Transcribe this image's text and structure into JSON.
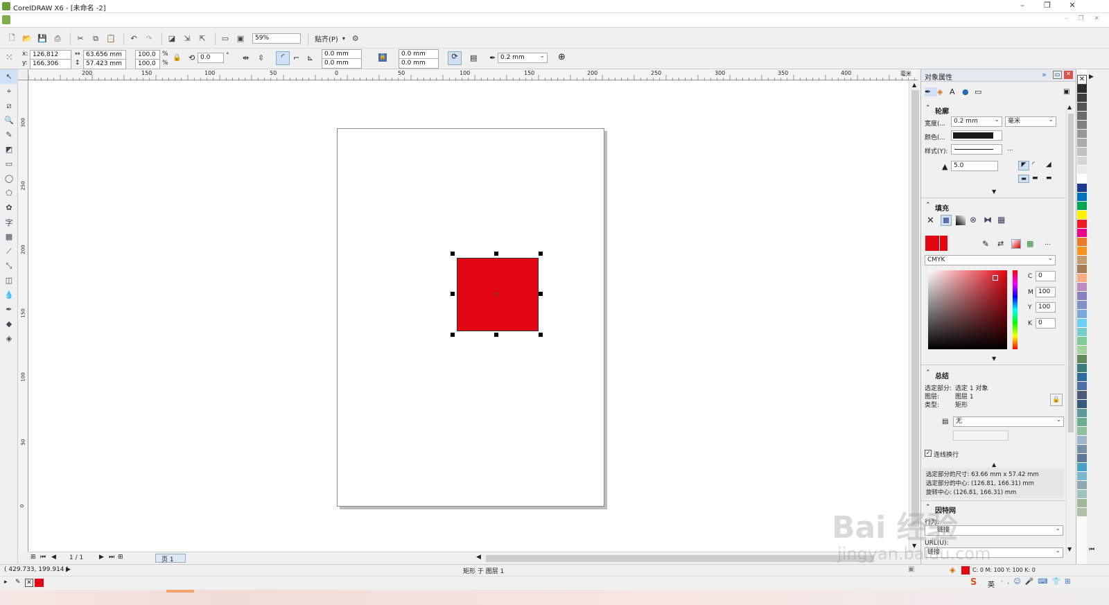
{
  "window": {
    "title": "CorelDRAW X6 - [未命名 -2]",
    "minimize": "–",
    "maximize": "❐",
    "close": "✕"
  },
  "toolbar": {
    "zoom": "59%",
    "snap": "贴齐(P)"
  },
  "propbar": {
    "x_label": "x:",
    "x": "126.812 mm",
    "y_label": "y:",
    "y": "166.306 mm",
    "w": "63.656 mm",
    "h": "57.423 mm",
    "scale_x": "100.0",
    "scale_y": "100.0",
    "percent": "%",
    "rotation": "0.0",
    "degree": "°",
    "corner1": "0.0 mm",
    "corner2": "0.0 mm",
    "corner3": "0.0 mm",
    "corner4": "0.0 mm",
    "outline_width": "0.2 mm"
  },
  "ruler": {
    "h_ticks": [
      "200",
      "150",
      "100",
      "50",
      "0",
      "50",
      "100",
      "150",
      "200",
      "250",
      "300",
      "350",
      "400"
    ],
    "unit": "毫米",
    "v_ticks": [
      "300",
      "250",
      "200",
      "150",
      "100",
      "50",
      "0"
    ]
  },
  "pager": {
    "page_count": "1 / 1",
    "page_tab": "页 1"
  },
  "status": {
    "coords": "( 429.733, 199.914 )",
    "object_info": "矩形 于 图层 1",
    "fill_info": "C: 0 M: 100 Y: 100 K: 0"
  },
  "panel": {
    "title": "对象属性",
    "outline": {
      "header": "轮廓",
      "width_label": "宽度(...",
      "width_value": "0.2 mm",
      "unit": "毫米",
      "color_label": "颜色(...",
      "style_label": "样式(Y):",
      "miter": "5.0",
      "more": "..."
    },
    "fill": {
      "header": "填充",
      "model": "CMYK",
      "c_label": "C",
      "c": "0",
      "m_label": "M",
      "m": "100",
      "y_label": "Y",
      "y": "100",
      "k_label": "K",
      "k": "0",
      "more": "..."
    },
    "summary": {
      "header": "总结",
      "selection_label": "选定部分:",
      "selection": "选定 1 对象",
      "layer_label": "图层:",
      "layer": "图层 1",
      "type_label": "类型:",
      "type": "矩形",
      "wrap": "无",
      "wrap_checkbox": "连线换行",
      "size_line": "选定部分的尺寸: 63.66 mm x 57.42 mm",
      "center_line": "选定部分的中心: (126.81, 166.31) mm",
      "rot_line": "旋转中心:          (126.81, 166.31) mm"
    },
    "internet": {
      "header": "因特网",
      "behavior_label": "行为:",
      "behavior": "链接",
      "url_label": "URL(U):",
      "url": "链接"
    }
  },
  "colors": {
    "fill": "#e30613",
    "palette": [
      "#2b2b2b",
      "#3e3e3e",
      "#555555",
      "#6b6b6b",
      "#808080",
      "#969696",
      "#ababab",
      "#c1c1c1",
      "#d6d6d6",
      "#ebebeb",
      "#ffffff",
      "#1d3a8e",
      "#0072bc",
      "#00a651",
      "#fff200",
      "#ed1c24",
      "#ec008c",
      "#e87b2a",
      "#f7941d",
      "#c69c6d",
      "#a67c52",
      "#f9ad81",
      "#bd8cbf",
      "#8781bd",
      "#8393ca",
      "#7da7d8",
      "#6dcff6",
      "#7accc8",
      "#82ca9c",
      "#a3d39c",
      "#5e8a5e",
      "#3c7b7b",
      "#2e6d9e",
      "#4a6fa5",
      "#4f5a7a",
      "#375a7f",
      "#5d9b9b",
      "#6aaf8f",
      "#8fc0a0",
      "#9fb7c8",
      "#7a8fa8",
      "#5c7a99",
      "#49a0c5",
      "#7bb8d0",
      "#8fa9b3",
      "#9cc4b8",
      "#a0b89a",
      "#b0c0a8"
    ]
  },
  "watermark": {
    "brand": "Bai 经验",
    "url": "jingyan.baidu.com"
  }
}
